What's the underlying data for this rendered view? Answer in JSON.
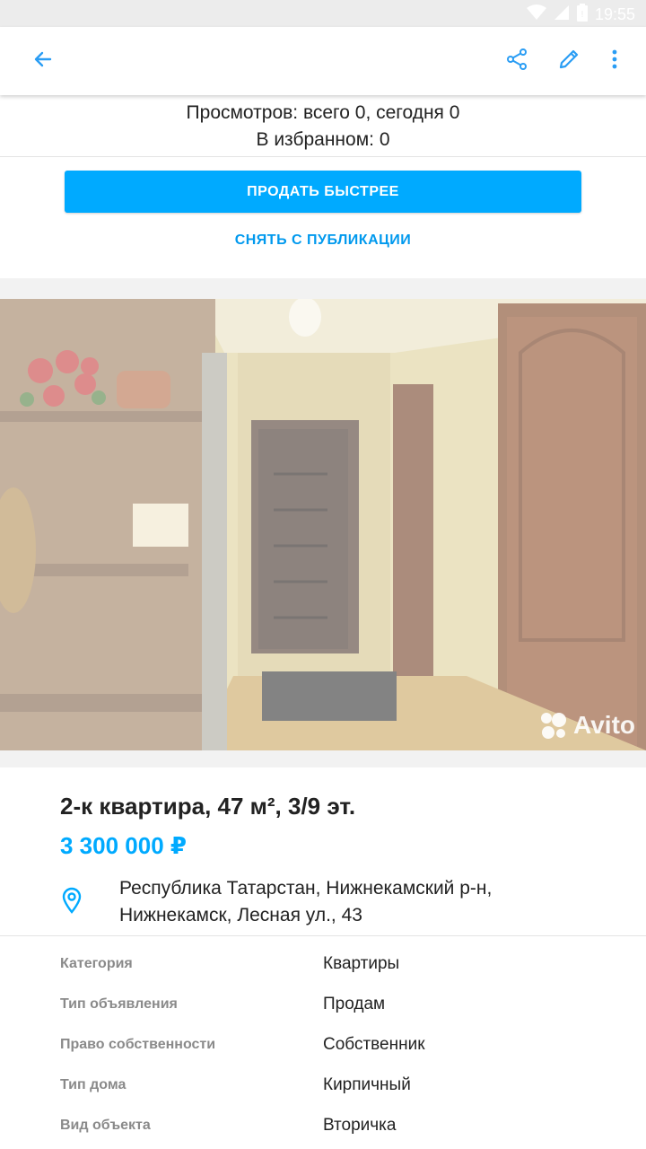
{
  "status": {
    "time": "19:55"
  },
  "appbar": {
    "back_icon": "arrow-left-icon",
    "share_icon": "share-icon",
    "edit_icon": "pencil-icon",
    "more_icon": "more-vert-icon",
    "accent": "#2a9df4"
  },
  "stats": {
    "views": "Просмотров: всего 0, сегодня 0",
    "favorites": "В избранном: 0"
  },
  "actions": {
    "sell_faster": "ПРОДАТЬ БЫСТРЕЕ",
    "unpublish": "СНЯТЬ С ПУБЛИКАЦИИ",
    "primary_color": "#00aaff"
  },
  "photo": {
    "watermark": "Avito"
  },
  "listing": {
    "title": "2-к квартира, 47 м², 3/9 эт.",
    "price": "3 300 000 ₽",
    "address_line1": "Республика Татарстан, Нижнекамский р-н,",
    "address_line2": "Нижнекамск, Лесная ул., 43",
    "price_color": "#00aaff"
  },
  "params": [
    {
      "key": "Категория",
      "value": "Квартиры"
    },
    {
      "key": "Тип объявления",
      "value": "Продам"
    },
    {
      "key": "Право собственности",
      "value": "Собственник"
    },
    {
      "key": "Тип дома",
      "value": "Кирпичный"
    },
    {
      "key": "Вид объекта",
      "value": "Вторичка"
    }
  ]
}
